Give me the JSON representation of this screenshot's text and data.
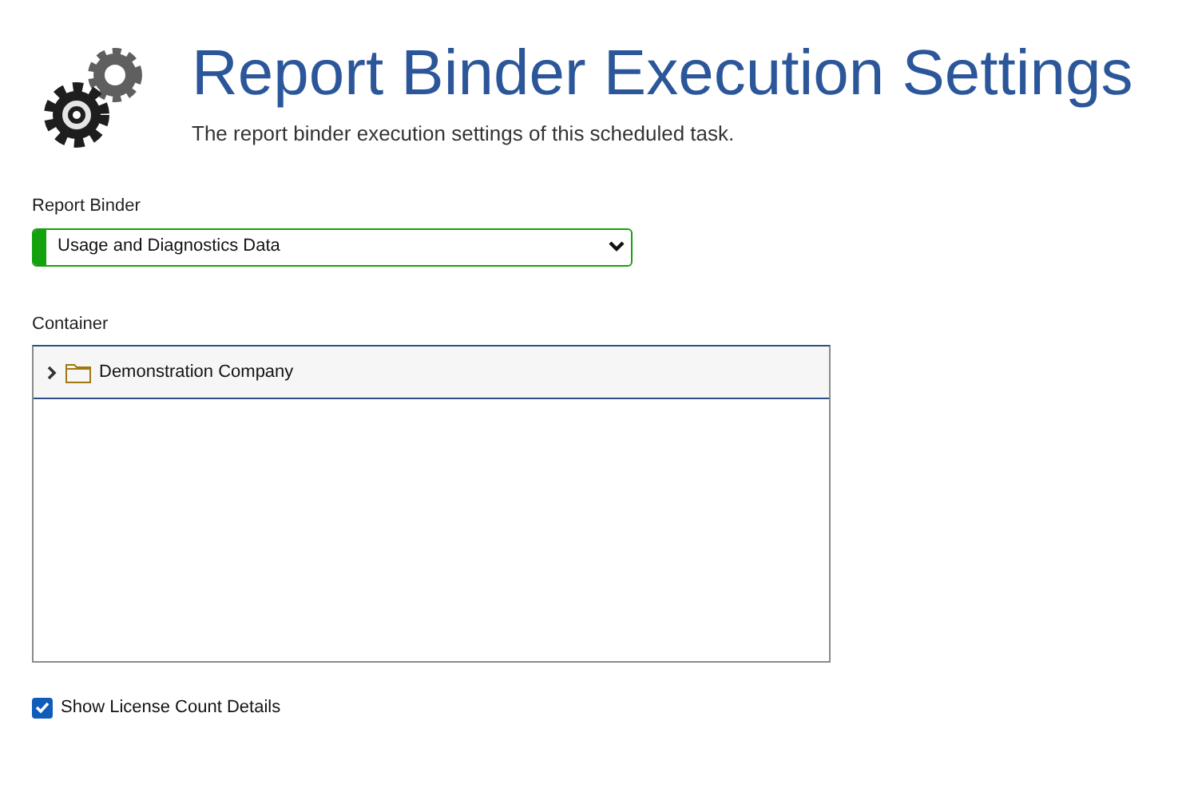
{
  "header": {
    "title": "Report Binder Execution Settings",
    "subtitle": "The report binder execution settings of this scheduled task."
  },
  "report_binder": {
    "label": "Report Binder",
    "value": "Usage and Diagnostics Data",
    "valid": true
  },
  "container": {
    "label": "Container",
    "tree": [
      {
        "label": "Demonstration Company",
        "expanded": false,
        "selected": true
      }
    ]
  },
  "options": [
    {
      "label": "Show License Count Details",
      "checked": true
    }
  ]
}
